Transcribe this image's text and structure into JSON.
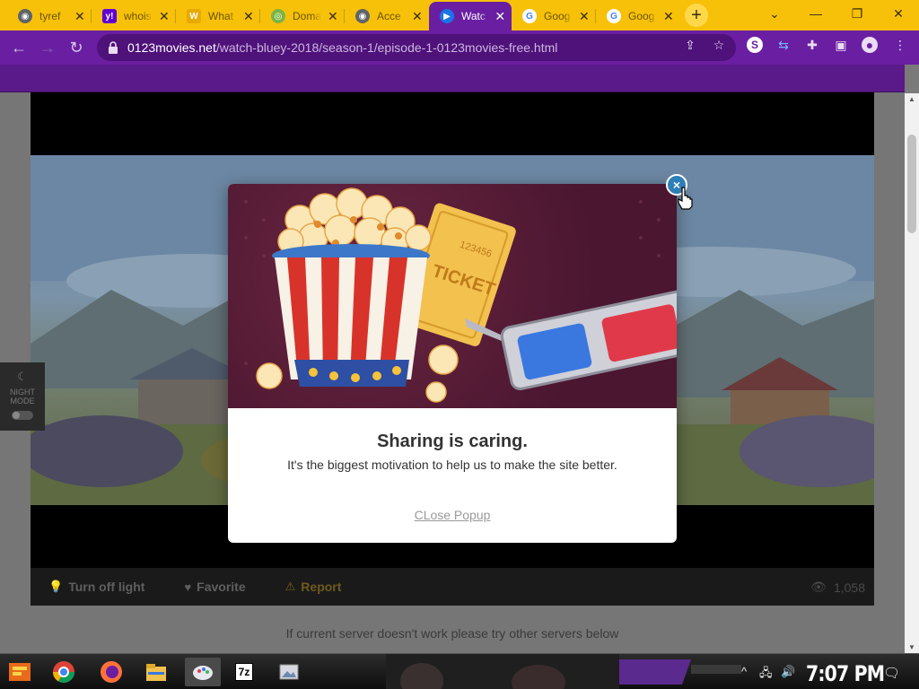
{
  "tabs": [
    {
      "title": "tyref",
      "favicon": "chrome-icon",
      "color": "#5f6368",
      "active": false
    },
    {
      "title": "whois",
      "favicon": "yahoo-icon",
      "color": "#6001d2",
      "active": false
    },
    {
      "title": "What",
      "favicon": "w-icon",
      "color": "#e8a900",
      "active": false
    },
    {
      "title": "Doma",
      "favicon": "domain-icon",
      "color": "#7cb342",
      "active": false
    },
    {
      "title": "Acce",
      "favicon": "chrome-icon",
      "color": "#5f6368",
      "active": false
    },
    {
      "title": "Watc",
      "favicon": "play-icon",
      "color": "#1a73e8",
      "active": true
    },
    {
      "title": "Goog",
      "favicon": "google-icon",
      "color": "#4285f4",
      "active": false
    },
    {
      "title": "Goog",
      "favicon": "google-icon",
      "color": "#4285f4",
      "active": false
    }
  ],
  "close_glyph": "✕",
  "new_tab_glyph": "+",
  "address_bar": {
    "domain": "0123movies.net",
    "path": "/watch-bluey-2018/season-1/episode-1-0123movies-free.html"
  },
  "player_controls": {
    "turn_off_light": "Turn off light",
    "favorite": "Favorite",
    "report": "Report",
    "views": "1,058"
  },
  "night_mode": {
    "label": "NIGHT MODE"
  },
  "server_note": "If current server doesn't work please try other servers below",
  "modal": {
    "title": "Sharing is caring.",
    "subtitle": "It's the biggest motivation to help us to make the site better.",
    "close_link": "CLose Popup",
    "close_glyph": "×",
    "ticket_text": "TICKET",
    "ticket_number": "123456"
  },
  "taskbar": {
    "clock": "7:07 PM",
    "apps": [
      "start-icon",
      "chrome-icon",
      "firefox-icon",
      "file-explorer-icon",
      "paint-icon",
      "7zip-icon",
      "photos-icon"
    ],
    "app_7zip_label": "7z"
  },
  "colors": {
    "tabstrip": "#f7c10a",
    "toolbar": "#6a1ea1",
    "active_tab": "#6a1ea1",
    "modal_close": "#2f7fb7"
  }
}
